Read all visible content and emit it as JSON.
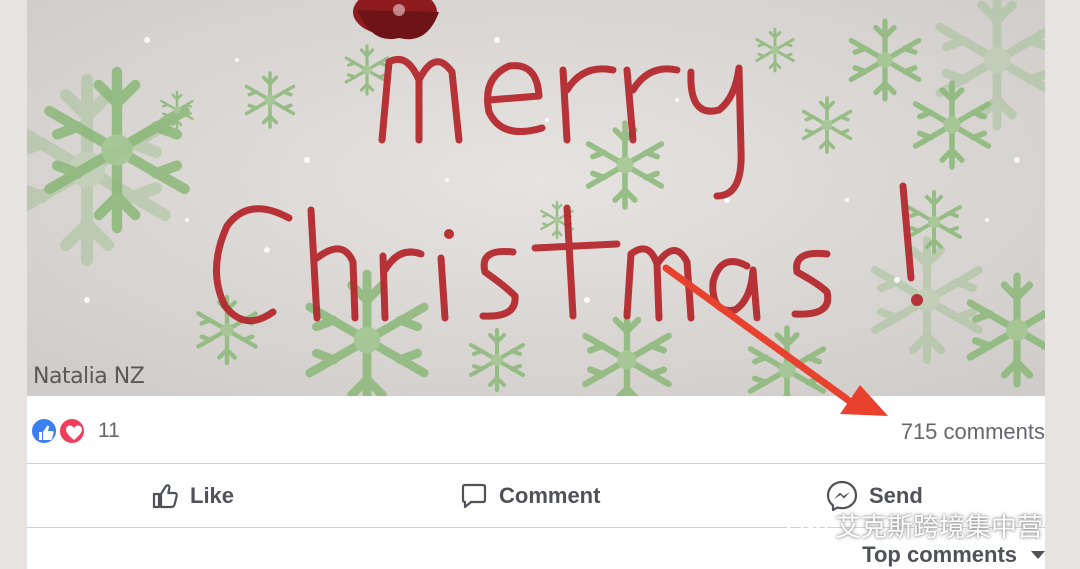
{
  "post": {
    "image": {
      "greeting_line1": "merry",
      "greeting_line2": "Christmas!",
      "credit": "Natalia NZ",
      "colors": {
        "background": "#d9d6d4",
        "text": "#b3242a",
        "snowflake": "#8bb878"
      }
    },
    "reactions": {
      "icons": [
        "like-icon",
        "love-icon"
      ],
      "count": "11"
    },
    "comments_count": "715 comments",
    "actions": {
      "like": "Like",
      "comment": "Comment",
      "send": "Send"
    },
    "sort_label": "Top comments"
  },
  "watermark": {
    "text": "艾克斯跨境集中营",
    "icon": "wechat-icon"
  },
  "annotation": {
    "type": "arrow",
    "color": "#e8412e",
    "points_to": "comments-count"
  }
}
